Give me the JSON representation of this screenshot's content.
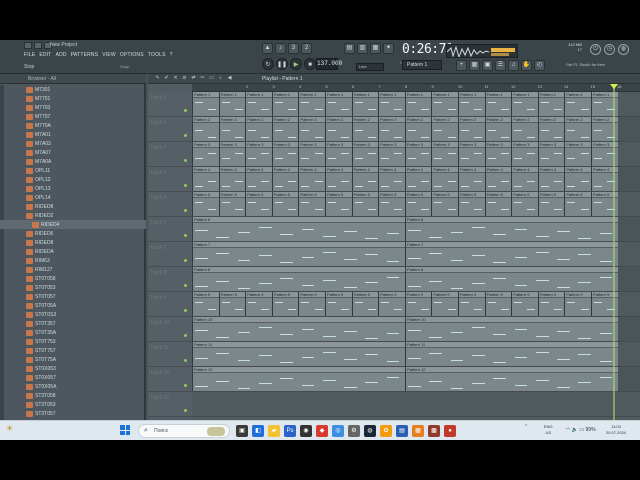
{
  "window": {
    "project_title": "New Project",
    "hint": "Stop",
    "hint_right": "Snap"
  },
  "menu": [
    "FILE",
    "EDIT",
    "ADD",
    "PATTERNS",
    "VIEW",
    "OPTIONS",
    "TOOLS",
    "?"
  ],
  "transport": {
    "tempo": "137.000",
    "time": "0:26:71",
    "time_sub": "M:S:CS",
    "pattern": "Pattern 1",
    "snap": "Line",
    "cpu": "410 MB",
    "cpu2": "17",
    "news": "Get FL Studio for free!"
  },
  "browser": {
    "title": "Browser - All",
    "items": [
      "M7301",
      "M7701",
      "M7703",
      "M7707",
      "M770A",
      "M7A01",
      "M7A03",
      "M7A07",
      "M7A0A",
      "OPL11",
      "OPL12",
      "OPL13",
      "OPL14",
      "RIDED8",
      "RIDED2",
      "RIDED4",
      "RIDED6",
      "RIDED8",
      "RIDEDA",
      "RIM63",
      "RIM127",
      "ST0T058",
      "ST0T053",
      "ST0T057",
      "ST0T05A",
      "ST0T0S3",
      "ST0T357",
      "ST0T35A",
      "ST0T753",
      "ST0T757",
      "ST0T75A",
      "ST0X053",
      "ST0X057",
      "ST0X05A",
      "ST3T058",
      "ST3T053",
      "ST3T057"
    ],
    "selected_index": 15
  },
  "playlist": {
    "title": "Playlist - Pattern 1",
    "ruler": [
      "2",
      "3",
      "4",
      "5",
      "6",
      "7",
      "8",
      "9",
      "10",
      "11",
      "12",
      "13",
      "14",
      "15",
      "16"
    ],
    "tracks": [
      "Track 1",
      "Track 2",
      "Track 3",
      "Track 4",
      "Track 5",
      "Track 6",
      "Track 7",
      "Track 8",
      "Track 9",
      "Track 10",
      "Track 11",
      "Track 12",
      "Track 13"
    ],
    "patterns": [
      "Pattern 1",
      "Pattern 2",
      "Pattern 3",
      "Pattern 4",
      "Pattern 5",
      "Pattern 6",
      "Pattern 7",
      "Pattern 8",
      "Pattern 9",
      "Pattern 10",
      "Pattern 11",
      "Pattern 12"
    ],
    "playhead_fraction": 0.94
  },
  "taskbar": {
    "search_placeholder": "Поиск",
    "lang": "ENG",
    "lang2": "US",
    "battery": "99%",
    "time": "11:03",
    "date": "20.07.2024"
  },
  "colors": {
    "accent": "#8fcc5b",
    "playhead": "#d8ef4b",
    "clip": "#8a969b"
  }
}
